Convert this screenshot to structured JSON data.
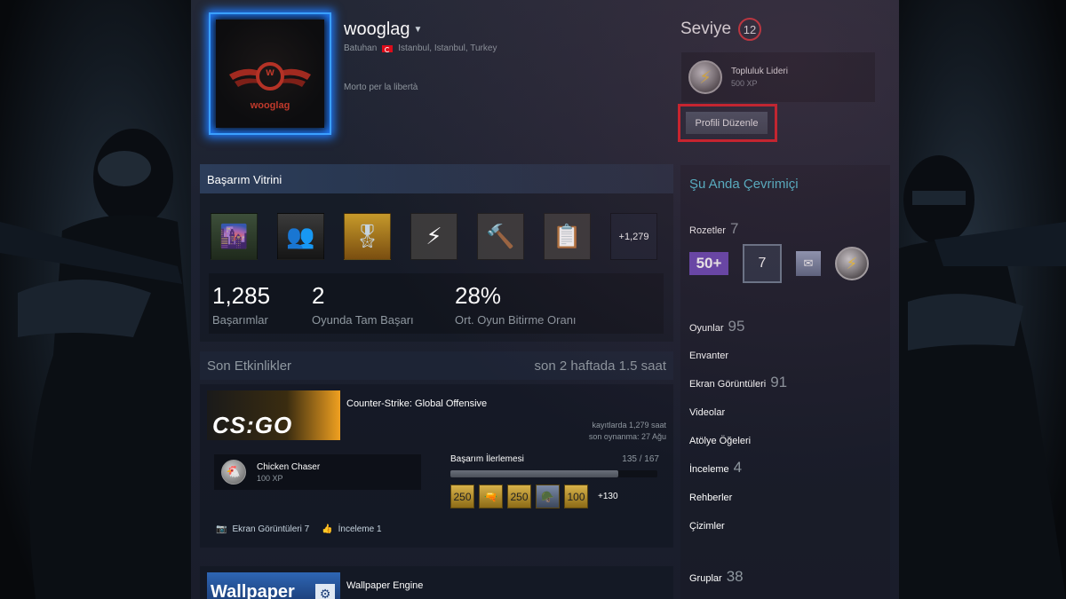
{
  "profile": {
    "persona_name": "wooglag",
    "real_name": "Batuhan",
    "location": "Istanbul, Istanbul, Turkey",
    "summary": "Morto per la libertà",
    "avatar_text": "wooglag",
    "avatar_letter": "w"
  },
  "level": {
    "label": "Seviye",
    "value": "12"
  },
  "favorite_badge": {
    "name": "Topluluk Lideri",
    "xp": "500 XP"
  },
  "edit_button": {
    "label": "Profili Düzenle"
  },
  "showcase": {
    "title": "Başarım Vitrini",
    "more": "+1,279",
    "stats": [
      {
        "value": "1,285",
        "label": "Başarımlar"
      },
      {
        "value": "2",
        "label": "Oyunda Tam Başarı"
      },
      {
        "value": "28%",
        "label": "Ort. Oyun Bitirme Oranı"
      }
    ]
  },
  "recent": {
    "title": "Son Etkinlikler",
    "summary": "son 2 haftada 1.5 saat"
  },
  "game1": {
    "capsule_text": "CS:GO",
    "name": "Counter-Strike: Global Offensive",
    "hours_record": "kayıtlarda 1,279 saat",
    "last_played": "son oynanma: 27 Ağu",
    "recent_achievement": {
      "name": "Chicken Chaser",
      "xp": "100 XP"
    },
    "progress": {
      "label": "Başarım İlerlemesi",
      "count": "135 / 167",
      "fraction": 0.81
    },
    "mini_achievements": [
      "250",
      "",
      "250",
      "",
      "100"
    ],
    "more_achievements": "+130",
    "links": [
      {
        "label": "Ekran Görüntüleri 7"
      },
      {
        "label": "İnceleme 1"
      }
    ]
  },
  "game2": {
    "capsule_text": "Wallpaper",
    "name": "Wallpaper Engine"
  },
  "sidebar": {
    "status": "Şu Anda Çevrimiçi",
    "badges": {
      "label": "Rozetler",
      "count": "7"
    },
    "badge_icons": {
      "b1": "50+",
      "b2": "7"
    },
    "games": {
      "label": "Oyunlar",
      "count": "95"
    },
    "inventory": {
      "label": "Envanter"
    },
    "screenshots": {
      "label": "Ekran Görüntüleri",
      "count": "91"
    },
    "videos": {
      "label": "Videolar"
    },
    "workshop": {
      "label": "Atölye Öğeleri"
    },
    "reviews": {
      "label": "İnceleme",
      "count": "4"
    },
    "guides": {
      "label": "Rehberler"
    },
    "artwork": {
      "label": "Çizimler"
    },
    "groups": {
      "label": "Gruplar",
      "count": "38"
    }
  }
}
